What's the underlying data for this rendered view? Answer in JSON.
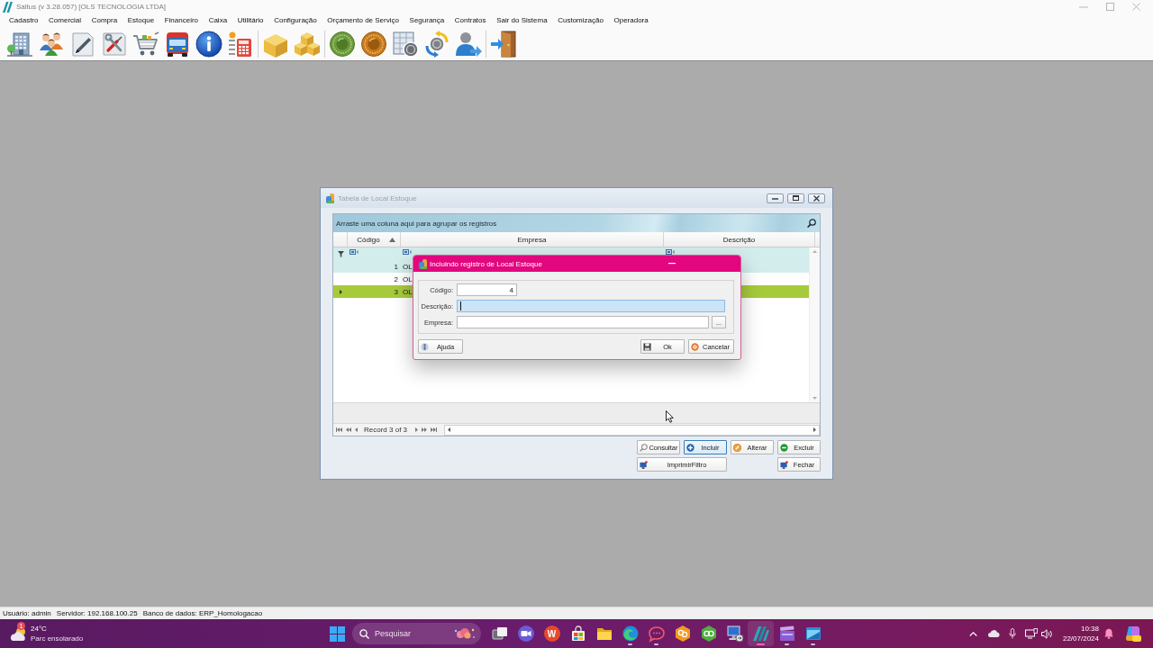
{
  "window": {
    "title": "Saltus (v 3.28.057) [OLS TECNOLOGIA LTDA]"
  },
  "menu": [
    "Cadastro",
    "Comercial",
    "Compra",
    "Estoque",
    "Financeiro",
    "Caixa",
    "Utilitário",
    "Configuração",
    "Orçamento de Serviço",
    "Segurança",
    "Contratos",
    "Sair do Sistema",
    "Customização",
    "Operadora"
  ],
  "child_window": {
    "title": "Tabela de Local Estoque",
    "active": false,
    "grid": {
      "group_hint": "Arraste uma coluna aqui para agrupar os registros",
      "columns": [
        {
          "label": "Código",
          "sorted": true
        },
        {
          "label": "Empresa",
          "sorted": false
        },
        {
          "label": "Descrição",
          "sorted": false
        }
      ],
      "rows": [
        {
          "codigo": "1",
          "empresa": "OL",
          "selected": false
        },
        {
          "codigo": "2",
          "empresa": "OL",
          "selected": false
        },
        {
          "codigo": "3",
          "empresa": "OL",
          "selected": true
        }
      ],
      "navigator": "Record 3 of 3"
    },
    "buttons": [
      {
        "label": "Consultar",
        "kind": "consult",
        "focused": false
      },
      {
        "label": "Incluir",
        "kind": "add",
        "focused": true
      },
      {
        "label": "Alterar",
        "kind": "edit",
        "focused": false
      },
      {
        "label": "Excluir",
        "kind": "delete",
        "focused": false
      },
      {
        "label": "ImprimirFiltro",
        "kind": "print",
        "focused": false
      },
      {
        "label": "Fechar",
        "kind": "close",
        "focused": false
      }
    ]
  },
  "dialog": {
    "title": "Incluindo registro de Local Estoque",
    "fields": [
      {
        "label": "Código:",
        "kind": "number",
        "value": "4",
        "focused": false
      },
      {
        "label": "Descrição:",
        "kind": "text",
        "focused": true
      },
      {
        "label": "Empresa:",
        "kind": "lookup",
        "lookup_button": "...",
        "focused": false
      }
    ],
    "buttons": [
      {
        "label": "Ajuda",
        "kind": "help"
      },
      {
        "label": "Ok",
        "kind": "save"
      },
      {
        "label": "Cancelar",
        "kind": "cancel"
      }
    ]
  },
  "status_bar": [
    "Usuário: admin",
    "Servidor: 192.168.100.25",
    "Banco de dados: ERP_Homologacao"
  ],
  "taskbar": {
    "weather": {
      "badge": "1",
      "temperature": "24°C",
      "condition": "Parc ensolarado"
    },
    "search": {
      "placeholder": "Pesquisar"
    },
    "apps": [
      {
        "kind": "task-view",
        "running": false,
        "active": false
      },
      {
        "kind": "meet",
        "running": false,
        "active": false
      },
      {
        "kind": "wps",
        "glyph": "W",
        "running": false,
        "active": false
      },
      {
        "kind": "store",
        "running": false,
        "active": false
      },
      {
        "kind": "folder",
        "running": false,
        "active": false
      },
      {
        "kind": "edge",
        "running": true,
        "active": false
      },
      {
        "kind": "chat",
        "running": true,
        "active": false
      },
      {
        "kind": "hex-orange",
        "running": false,
        "active": false
      },
      {
        "kind": "hex-green",
        "running": false,
        "active": false
      },
      {
        "kind": "remote",
        "running": false,
        "active": false
      },
      {
        "kind": "saltus",
        "running": true,
        "active": true
      },
      {
        "kind": "clapper",
        "running": true,
        "active": false
      },
      {
        "kind": "window",
        "running": true,
        "active": false
      }
    ],
    "clock": {
      "time": "10:38",
      "date": "22/07/2024"
    }
  }
}
